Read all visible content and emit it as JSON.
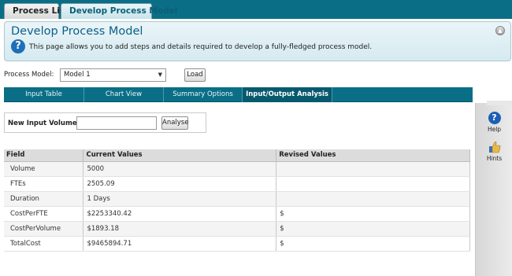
{
  "top_tabs": [
    {
      "label": "Process List"
    },
    {
      "label": "Develop Process Model"
    }
  ],
  "header": {
    "title": "Develop Process Model",
    "description": "This page allows you to add steps and details required to develop a fully-fledged process model.",
    "help_glyph": "?",
    "collapse_glyph": "^"
  },
  "process_model": {
    "label": "Process Model:",
    "selected": "Model 1",
    "load_label": "Load"
  },
  "tabs": [
    {
      "label": "Input Table"
    },
    {
      "label": "Chart View"
    },
    {
      "label": "Summary Options"
    },
    {
      "label": "Input/Output Analysis"
    }
  ],
  "analysis": {
    "label": "New Input Volume:",
    "value": "",
    "analyse_label": "Analyse"
  },
  "table": {
    "headers": [
      "Field",
      "Current Values",
      "Revised Values"
    ],
    "rows": [
      {
        "field": "Volume",
        "current": "5000",
        "revised": ""
      },
      {
        "field": "FTEs",
        "current": "2505.09",
        "revised": ""
      },
      {
        "field": "Duration",
        "current": "1 Days",
        "revised": ""
      },
      {
        "field": "CostPerFTE",
        "current": "$2253340.42",
        "revised": "$"
      },
      {
        "field": "CostPerVolume",
        "current": "$1893.18",
        "revised": "$"
      },
      {
        "field": "TotalCost",
        "current": "$9465894.71",
        "revised": "$"
      }
    ]
  },
  "sidebar": {
    "help_label": "Help",
    "hints_label": "Hints",
    "help_glyph": "?"
  },
  "colors": {
    "brand_teal": "#0a6f86",
    "title_blue": "#0b5f8a",
    "help_blue": "#1d5fb4"
  }
}
